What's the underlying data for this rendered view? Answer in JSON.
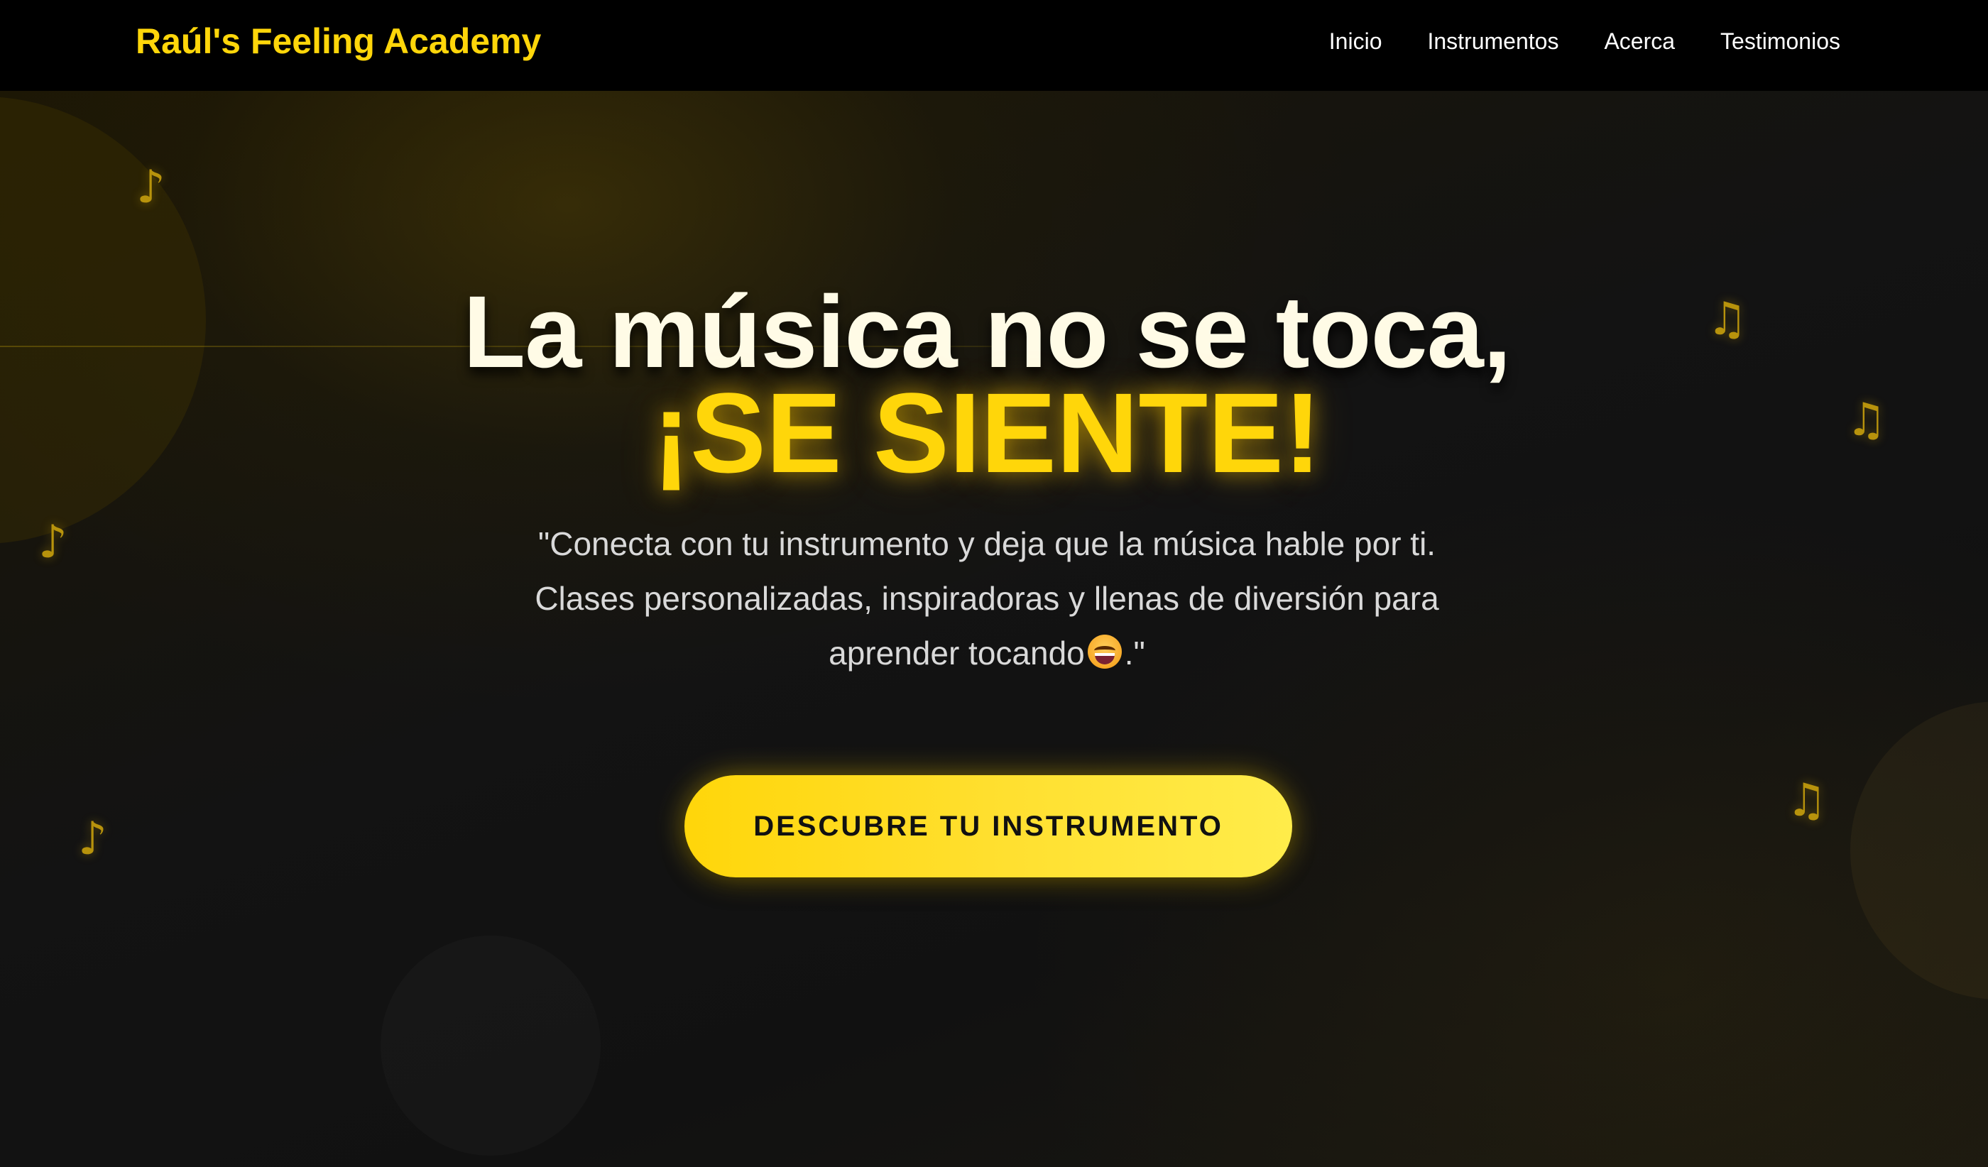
{
  "header": {
    "brand": "Raúl's Feeling Academy",
    "nav": [
      {
        "label": "Inicio"
      },
      {
        "label": "Instrumentos"
      },
      {
        "label": "Acerca"
      },
      {
        "label": "Testimonios"
      }
    ]
  },
  "hero": {
    "title_line1": "La música no se toca,",
    "title_line2": "¡SE SIENTE!",
    "subtitle_part1": "\"Conecta con tu instrumento y deja que la música hable por ti. Clases personalizadas, inspiradoras y llenas de diversión para aprender tocando",
    "subtitle_part2": ".\"",
    "emoji_icon": "grinning-face-emoji",
    "cta_label": "DESCUBRE TU INSTRUMENTO"
  },
  "decorations": {
    "note_glyph_single": "♪",
    "note_glyph_double": "♫"
  },
  "colors": {
    "accent": "#ffd60a",
    "header_bg": "#000000",
    "background": "#111111",
    "title_text": "#fffbe6",
    "subtitle_text": "#d9d9d9"
  }
}
